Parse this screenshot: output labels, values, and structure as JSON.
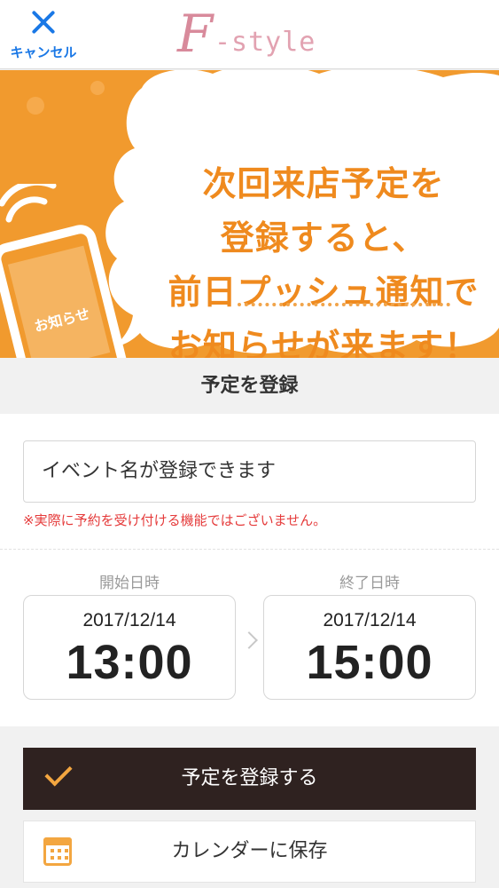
{
  "header": {
    "cancel_label": "キャンセル",
    "logo_initial": "F",
    "logo_rest": "-style"
  },
  "banner": {
    "lines": [
      "次回来店予定を",
      "登録すると、",
      "前日プッシュ通知で",
      "お知らせが来ます！"
    ],
    "phone_label": "お知らせ"
  },
  "section": {
    "title": "予定を登録"
  },
  "form": {
    "event_placeholder": "イベント名が登録できます",
    "notice": "※実際に予約を受け付ける機能ではございません。",
    "start": {
      "label": "開始日時",
      "date": "2017/12/14",
      "time": "13:00"
    },
    "end": {
      "label": "終了日時",
      "date": "2017/12/14",
      "time": "15:00"
    }
  },
  "actions": {
    "register_label": "予定を登録する",
    "calendar_label": "カレンダーに保存"
  },
  "colors": {
    "accent_blue": "#1a78e6",
    "banner_orange": "#f19a2e",
    "text_orange": "#ef8a1e",
    "notice_red": "#e53b3b",
    "dark_button": "#2f2220"
  }
}
